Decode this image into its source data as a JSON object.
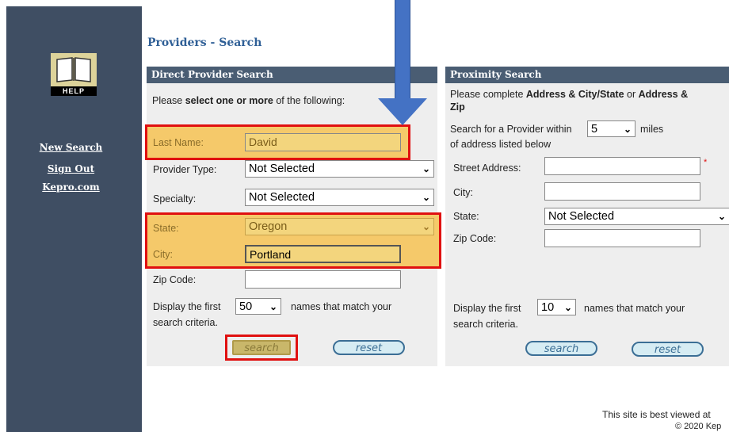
{
  "sidebar": {
    "help_label": "HELP",
    "links": [
      "New Search",
      "Sign Out",
      "Kepro.com"
    ]
  },
  "page": {
    "title": "Providers - Search"
  },
  "direct": {
    "header": "Direct Provider Search",
    "instruction_pre": "Please ",
    "instruction_bold": "select one or more",
    "instruction_post": " of the following:",
    "last_name_label": "Last Name:",
    "last_name_value": "David",
    "provider_type_label": "Provider Type:",
    "provider_type_value": "Not Selected",
    "specialty_label": "Specialty:",
    "specialty_value": "Not Selected",
    "state_label": "State:",
    "state_value": "Oregon",
    "city_label": "City:",
    "city_value": "Portland",
    "zip_label": "Zip Code:",
    "zip_value": "",
    "display_pre": "Display the first",
    "display_count": "50",
    "display_post": "names that match your",
    "display_post2": "search criteria.",
    "search_label": "search",
    "reset_label": "reset"
  },
  "proximity": {
    "header": "Proximity Search",
    "instruction_pre": "Please complete ",
    "instruction_b1": "Address & City/State",
    "instruction_mid": " or ",
    "instruction_b2": "Address &",
    "instruction_b3": "Zip",
    "within_pre": "Search for a Provider within",
    "within_value": "5",
    "within_post": "miles",
    "within_line2": "of address listed below",
    "street_label": "Street Address:",
    "street_value": "",
    "required_mark": "*",
    "city_label": "City:",
    "city_value": "",
    "state_label": "State:",
    "state_value": "Not Selected",
    "zip_label": "Zip Code:",
    "zip_value": "",
    "display_pre": "Display the first",
    "display_count": "10",
    "display_post": "names that match your",
    "display_post2": "search criteria.",
    "search_label": "search",
    "reset_label": "reset"
  },
  "footer": {
    "line1": "This site is best viewed at",
    "line2": "© 2020 Kep"
  },
  "colors": {
    "sidebar": "#3f4e63",
    "panel_header": "#4a5d73",
    "title": "#2f5f96",
    "highlight_border": "#e01010",
    "highlight_fill": "#f5c96a",
    "arrow": "#4472c4"
  },
  "icons": {
    "help": "book-icon",
    "annotation": "down-arrow-icon"
  }
}
